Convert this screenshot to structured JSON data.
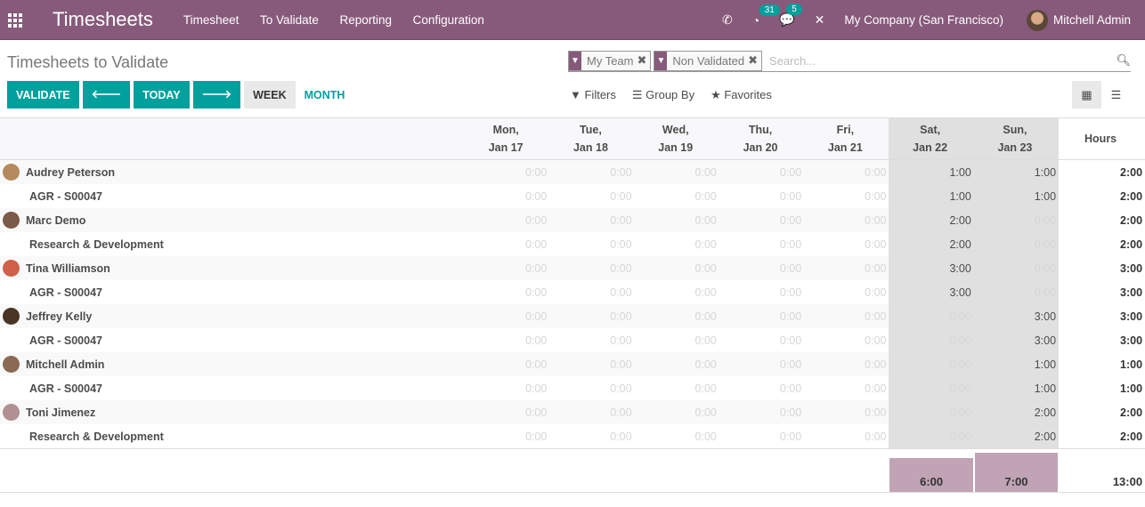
{
  "nav": {
    "brand": "Timesheets",
    "menu": [
      "Timesheet",
      "To Validate",
      "Reporting",
      "Configuration"
    ],
    "activity_count": "31",
    "message_count": "5",
    "company": "My Company (San Francisco)",
    "user": "Mitchell Admin"
  },
  "page": {
    "title": "Timesheets to Validate",
    "validate": "VALIDATE",
    "today": "TODAY",
    "week": "WEEK",
    "month": "MONTH"
  },
  "search": {
    "facets": [
      "My Team",
      "Non Validated"
    ],
    "placeholder": "Search...",
    "filters": "Filters",
    "group_by": "Group By",
    "favorites": "Favorites"
  },
  "colors": {
    "brand": "#875a7b",
    "accent": "#00a09d"
  },
  "grid": {
    "days": [
      [
        "Mon,",
        "Jan 17"
      ],
      [
        "Tue,",
        "Jan 18"
      ],
      [
        "Wed,",
        "Jan 19"
      ],
      [
        "Thu,",
        "Jan 20"
      ],
      [
        "Fri,",
        "Jan 21"
      ],
      [
        "Sat,",
        "Jan 22"
      ],
      [
        "Sun,",
        "Jan 23"
      ]
    ],
    "total_label": "Hours",
    "rows": [
      {
        "name": "Audrey Peterson",
        "employee": true,
        "avatar": "#b58a5f",
        "values": [
          "0:00",
          "0:00",
          "0:00",
          "0:00",
          "0:00",
          "1:00",
          "1:00"
        ],
        "total": "2:00"
      },
      {
        "name": "AGR - S00047",
        "values": [
          "0:00",
          "0:00",
          "0:00",
          "0:00",
          "0:00",
          "1:00",
          "1:00"
        ],
        "total": "2:00"
      },
      {
        "name": "Marc Demo",
        "employee": true,
        "avatar": "#7a5a48",
        "values": [
          "0:00",
          "0:00",
          "0:00",
          "0:00",
          "0:00",
          "2:00",
          "0:00"
        ],
        "total": "2:00"
      },
      {
        "name": "Research & Development",
        "values": [
          "0:00",
          "0:00",
          "0:00",
          "0:00",
          "0:00",
          "2:00",
          "0:00"
        ],
        "total": "2:00"
      },
      {
        "name": "Tina Williamson",
        "employee": true,
        "avatar": "#d0604a",
        "values": [
          "0:00",
          "0:00",
          "0:00",
          "0:00",
          "0:00",
          "3:00",
          "0:00"
        ],
        "total": "3:00"
      },
      {
        "name": "AGR - S00047",
        "values": [
          "0:00",
          "0:00",
          "0:00",
          "0:00",
          "0:00",
          "3:00",
          "0:00"
        ],
        "total": "3:00"
      },
      {
        "name": "Jeffrey Kelly",
        "employee": true,
        "avatar": "#4a3426",
        "values": [
          "0:00",
          "0:00",
          "0:00",
          "0:00",
          "0:00",
          "0:00",
          "3:00"
        ],
        "total": "3:00"
      },
      {
        "name": "AGR - S00047",
        "values": [
          "0:00",
          "0:00",
          "0:00",
          "0:00",
          "0:00",
          "0:00",
          "3:00"
        ],
        "total": "3:00"
      },
      {
        "name": "Mitchell Admin",
        "employee": true,
        "avatar": "#8a6a55",
        "values": [
          "0:00",
          "0:00",
          "0:00",
          "0:00",
          "0:00",
          "0:00",
          "1:00"
        ],
        "total": "1:00"
      },
      {
        "name": "AGR - S00047",
        "values": [
          "0:00",
          "0:00",
          "0:00",
          "0:00",
          "0:00",
          "0:00",
          "1:00"
        ],
        "total": "1:00"
      },
      {
        "name": "Toni Jimenez",
        "employee": true,
        "avatar": "#b09090",
        "values": [
          "0:00",
          "0:00",
          "0:00",
          "0:00",
          "0:00",
          "0:00",
          "2:00"
        ],
        "total": "2:00"
      },
      {
        "name": "Research & Development",
        "values": [
          "0:00",
          "0:00",
          "0:00",
          "0:00",
          "0:00",
          "0:00",
          "2:00"
        ],
        "total": "2:00"
      }
    ],
    "day_totals": [
      "",
      "",
      "",
      "",
      "",
      "6:00",
      "7:00"
    ],
    "day_total_hours": [
      0,
      0,
      0,
      0,
      0,
      6,
      7
    ],
    "grand_total": "13:00"
  }
}
